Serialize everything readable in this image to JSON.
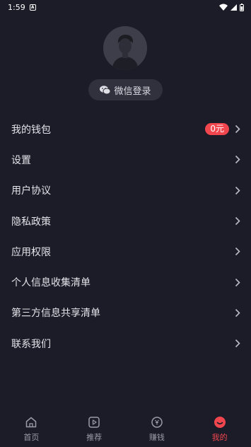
{
  "status_bar": {
    "time": "1:59"
  },
  "profile": {
    "login_label": "微信登录"
  },
  "menu": [
    {
      "label": "我的钱包",
      "badge": "0元"
    },
    {
      "label": "设置"
    },
    {
      "label": "用户协议"
    },
    {
      "label": "隐私政策"
    },
    {
      "label": "应用权限"
    },
    {
      "label": "个人信息收集清单"
    },
    {
      "label": "第三方信息共享清单"
    },
    {
      "label": "联系我们"
    }
  ],
  "bottom_nav": [
    {
      "label": "首页",
      "icon": "home-icon"
    },
    {
      "label": "推荐",
      "icon": "play-icon"
    },
    {
      "label": "赚钱",
      "icon": "coin-icon"
    },
    {
      "label": "我的",
      "icon": "smile-icon",
      "active": true
    }
  ],
  "colors": {
    "background": "#1b1c27",
    "accent": "#f2464f"
  }
}
